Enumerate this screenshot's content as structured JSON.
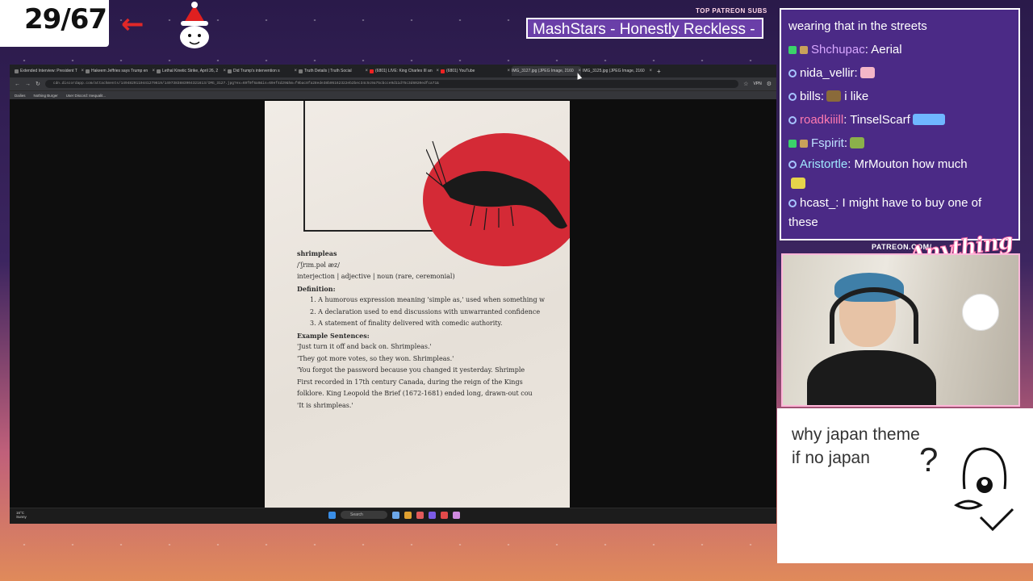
{
  "overlay": {
    "counter": "29/67",
    "arrow": "←",
    "top_patreon_label": "TOP PATREON SUBS",
    "ticker_text": "MashStars - Honestly Reckless -",
    "patreon_label": "PATREON.COM/",
    "brand_script": "AnythingElse"
  },
  "browser": {
    "tabs": [
      {
        "label": "Extended Interview: President T"
      },
      {
        "label": "Hakeem Jeffries says Trump en"
      },
      {
        "label": "Lethal Kinetic Strike, April 26, 2"
      },
      {
        "label": "Did Trump's intervention s"
      },
      {
        "label": "Truth Details | Truth Social"
      },
      {
        "label": "(6801) LIVE: King Charles III an"
      },
      {
        "label": "(6801) YouTube"
      },
      {
        "label": "IMG_3127.jpg (JPEG Image, 2160"
      },
      {
        "label": "IMG_3125.jpg (JPEG Image, 2160"
      }
    ],
    "url": "cdn.discordapp.com/attachments/1494829110441279619/1497383883904321613/IMG_3127.jpg?ex=69f0f6a9&is=69ef4d29&hm=f9bac8fa28ede38b05162322eb2bec34c5c9a75cbcce9d11d75c3d6020edfca71&",
    "vpn": "VPN",
    "bookmarks": [
      "Dailies",
      "Nothing Burger",
      "User Discord: Inequalit..."
    ]
  },
  "shirt": {
    "word": "shrimpleas",
    "pron": "/ˈʃrɪm.pəl æz/",
    "pos": "interjection | adjective | noun (rare, ceremonial)",
    "def_head": "Definition:",
    "def1": "1. A humorous expression meaning 'simple as,' used when something w",
    "def2": "2. A declaration used to end discussions with unwarranted confidence",
    "def3": "3. A statement of finality delivered with comedic authority.",
    "ex_head": "Example Sentences:",
    "ex1": "'Just turn it off and back on. Shrimpleas.'",
    "ex2": "'They got more votes, so they won. Shrimpleas.'",
    "ex3": "'You forgot the password because you changed it yesterday. Shrimple",
    "hist1": "First recorded in 17th century Canada, during the reign of the Kings",
    "hist2": "folklore. King Leopold the Brief (1672-1681) ended long, drawn-out cou",
    "hist3": "'It is shrimpleas.'"
  },
  "taskbar": {
    "temp": "16°C",
    "condition": "Sunny",
    "search": "Search"
  },
  "chat": {
    "messages": [
      {
        "user": "",
        "text": "wearing that in the streets",
        "color": "#ffffff",
        "badge": ""
      },
      {
        "user": "Shchupac",
        "text": "Aerial",
        "color": "#d7a7ff",
        "badge": "k-s"
      },
      {
        "user": "nida_vellir",
        "text": "",
        "color": "#ffffff",
        "badge": "p"
      },
      {
        "user": "bills",
        "text": "i like",
        "color": "#ffffff",
        "badge": "p"
      },
      {
        "user": "roadkiiill",
        "text": "TinselScarf",
        "color": "#ff7ab0",
        "badge": "p"
      },
      {
        "user": "Fspirit",
        "text": "",
        "color": "#bde0ff",
        "badge": "k-s"
      },
      {
        "user": "Aristortle",
        "text": "MrMouton how much",
        "color": "#9fe8ff",
        "badge": "p"
      },
      {
        "user": "hcast_",
        "text": "I might have to buy one of these",
        "color": "#ffffff",
        "badge": "p"
      }
    ]
  },
  "drawing": {
    "line1": "why japan theme",
    "line2": "if no japan",
    "mark": "?"
  }
}
